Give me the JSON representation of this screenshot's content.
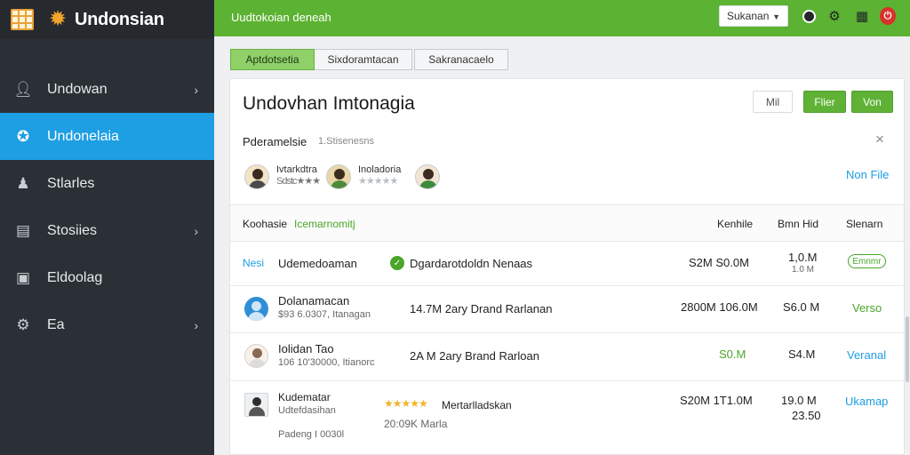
{
  "app": {
    "name": "Undonsian"
  },
  "colors": {
    "accent_green": "#5cb232",
    "sidebar_bg": "#2b3036",
    "active_blue": "#1e9ee3"
  },
  "sidebar": {
    "items": [
      {
        "label": "Undowan",
        "icon": "person-icon",
        "chevron": "›"
      },
      {
        "label": "Undonelaia",
        "icon": "badge-icon",
        "chevron": ""
      },
      {
        "label": "Stlarles",
        "icon": "people-icon",
        "chevron": ""
      },
      {
        "label": "Stosiies",
        "icon": "document-icon",
        "chevron": "›"
      },
      {
        "label": "Eldoolag",
        "icon": "inbox-icon",
        "chevron": ""
      },
      {
        "label": "Ea",
        "icon": "gear-icon",
        "chevron": "›"
      }
    ]
  },
  "topbar": {
    "title": "Uudtokoian deneah",
    "select_value": "Sukanan"
  },
  "tabs": [
    {
      "label": "Aptdotsetia"
    },
    {
      "label": "Sixdoramtacan"
    },
    {
      "label": "Sakranacaelo"
    }
  ],
  "card": {
    "title": "Undovhan Imtonagia",
    "buttons": {
      "min": "Mil",
      "filter": "Flier",
      "new": "Von"
    },
    "params_label": "Pderamelsie",
    "params_count": "1.Stisenesns",
    "close": "×",
    "more_file": "Non File",
    "reviewers": [
      {
        "name": "Ivtarkdtra",
        "rating_stars": "★★★★",
        "sub": "Sdstc★★★"
      },
      {
        "name": "Inoladoria",
        "rating_stars": "★★",
        "sub": "★★★★★"
      }
    ]
  },
  "table": {
    "headers": {
      "name": "Koohasie",
      "category": "Icemarnomitj",
      "c1": "Kenhile",
      "c2": "Bmn Hid",
      "c3": "Slenarn"
    },
    "rows": [
      {
        "tag": "Nesi",
        "name": "Udemedoaman",
        "desc": "Dgardarotdoldn Nenaas",
        "v1": "S2M S0.0M",
        "v2": "1,0.M",
        "v2b": "1.0 M",
        "status": "Emnmr"
      },
      {
        "name": "Dolanamacan",
        "sub": "$93 6.0307, Itanagan",
        "desc": "14.7M 2ary Drand Rarlanan",
        "v1": "2800M 106.0M",
        "v2": "S6.0 M",
        "status": "Verso"
      },
      {
        "name": "Iolidan Tao",
        "sub": "106 10'30000, Itianorc",
        "desc": "2A M 2ary Brand Rarloan",
        "v1": "S0.M",
        "v2": "S4.M",
        "status": "Veranal"
      },
      {
        "name": "Kudematar",
        "sub": "Udtefdasihan",
        "stars": "★★★★★",
        "desc": "Mertarlladskan",
        "desc2": "20:09K Marla",
        "sub2": "Padeng I 0030l",
        "v1": "S20M 1T1.0M",
        "v2": "19.0 M",
        "v2b": "23.50",
        "status": "Ukamap"
      }
    ]
  }
}
